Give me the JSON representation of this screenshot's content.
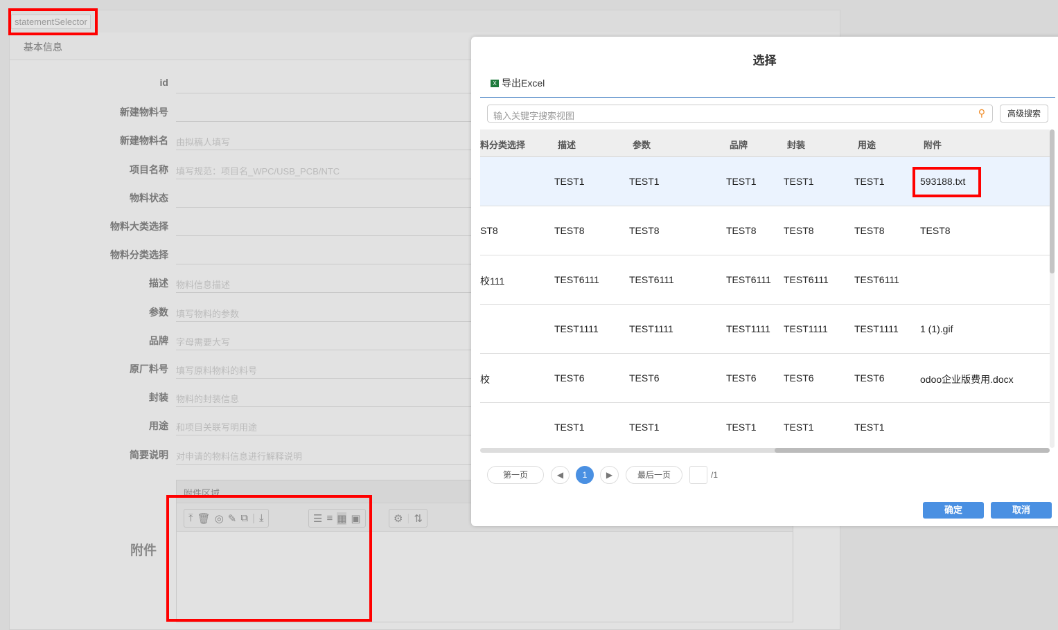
{
  "page": {
    "tab_label": "statementSelector",
    "section_title": "基本信息",
    "fields": [
      {
        "label": "id",
        "placeholder": ""
      },
      {
        "label": "新建物料号",
        "placeholder": ""
      },
      {
        "label": "新建物料名",
        "placeholder": "由拟稿人填写"
      },
      {
        "label": "项目名称",
        "placeholder": "填写规范：项目名_WPC/USB_PCB/NTC"
      },
      {
        "label": "物料状态",
        "placeholder": ""
      },
      {
        "label": "物料大类选择",
        "placeholder": ""
      },
      {
        "label": "物料分类选择",
        "placeholder": ""
      },
      {
        "label": "描述",
        "placeholder": "物料信息描述"
      },
      {
        "label": "参数",
        "placeholder": "填写物料的参数"
      },
      {
        "label": "品牌",
        "placeholder": "字母需要大写"
      },
      {
        "label": "原厂料号",
        "placeholder": "填写原料物料的料号"
      },
      {
        "label": "封装",
        "placeholder": "物料的封装信息"
      },
      {
        "label": "用途",
        "placeholder": "和项目关联写明用途"
      },
      {
        "label": "简要说明",
        "placeholder": "对申请的物料信息进行解释说明"
      }
    ],
    "attachment_label": "附件",
    "attachment_area_title": "附件区域"
  },
  "modal": {
    "title": "选择",
    "export_label": "导出Excel",
    "search_placeholder": "输入关键字搜索视图",
    "advanced_search": "高级搜索",
    "columns": [
      "料分类选择",
      "描述",
      "参数",
      "品牌",
      "封装",
      "用途",
      "附件"
    ],
    "rows": [
      [
        "",
        "TEST1",
        "TEST1",
        "TEST1",
        "TEST1",
        "TEST1",
        "593188.txt"
      ],
      [
        "ST8",
        "TEST8",
        "TEST8",
        "TEST8",
        "TEST8",
        "TEST8",
        "TEST8"
      ],
      [
        "校111",
        "TEST6111",
        "TEST6111",
        "TEST6111",
        "TEST6111",
        "TEST6111",
        ""
      ],
      [
        "",
        "TEST1111",
        "TEST1111",
        "TEST1111",
        "TEST1111",
        "TEST1111",
        "1 (1).gif"
      ],
      [
        "校",
        "TEST6",
        "TEST6",
        "TEST6",
        "TEST6",
        "TEST6",
        "odoo企业版费用.docx"
      ],
      [
        "",
        "TEST1",
        "TEST1",
        "TEST1",
        "TEST1",
        "TEST1",
        ""
      ]
    ],
    "pagination": {
      "first": "第一页",
      "current": "1",
      "last": "最后一页",
      "total": "/1"
    },
    "confirm": "确定",
    "cancel": "取消"
  }
}
